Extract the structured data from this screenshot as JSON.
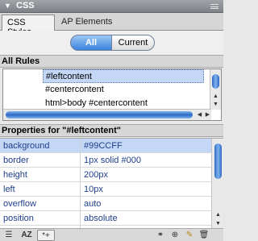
{
  "panel": {
    "title": "CSS"
  },
  "tabs": [
    {
      "label": "CSS Styles"
    },
    {
      "label": "AP Elements"
    }
  ],
  "mode_toggle": {
    "all_label": "All",
    "current_label": "Current",
    "selected": "All"
  },
  "all_rules": {
    "header": "All Rules",
    "items": [
      "#leftcontent",
      "#centercontent",
      "html>body #centercontent"
    ],
    "selected_index": 0
  },
  "properties": {
    "header": "Properties for \"#leftcontent\"",
    "rows": [
      {
        "name": "background",
        "value": "#99CCFF"
      },
      {
        "name": "border",
        "value": "1px solid #000"
      },
      {
        "name": "height",
        "value": "200px"
      },
      {
        "name": "left",
        "value": "10px"
      },
      {
        "name": "overflow",
        "value": "auto"
      },
      {
        "name": "position",
        "value": "absolute"
      }
    ],
    "selected_index": 0
  },
  "toolbar": {
    "left_icons": [
      "category-view-icon",
      "alphabetical-view-icon",
      "set-properties-view-icon"
    ],
    "right_icons": [
      "attach-stylesheet-icon",
      "new-css-rule-icon",
      "edit-style-icon",
      "delete-rule-icon"
    ]
  },
  "colors": {
    "accent": "#3a84de",
    "selection": "#c4d7f6",
    "property_text": "#1f3e8a"
  }
}
